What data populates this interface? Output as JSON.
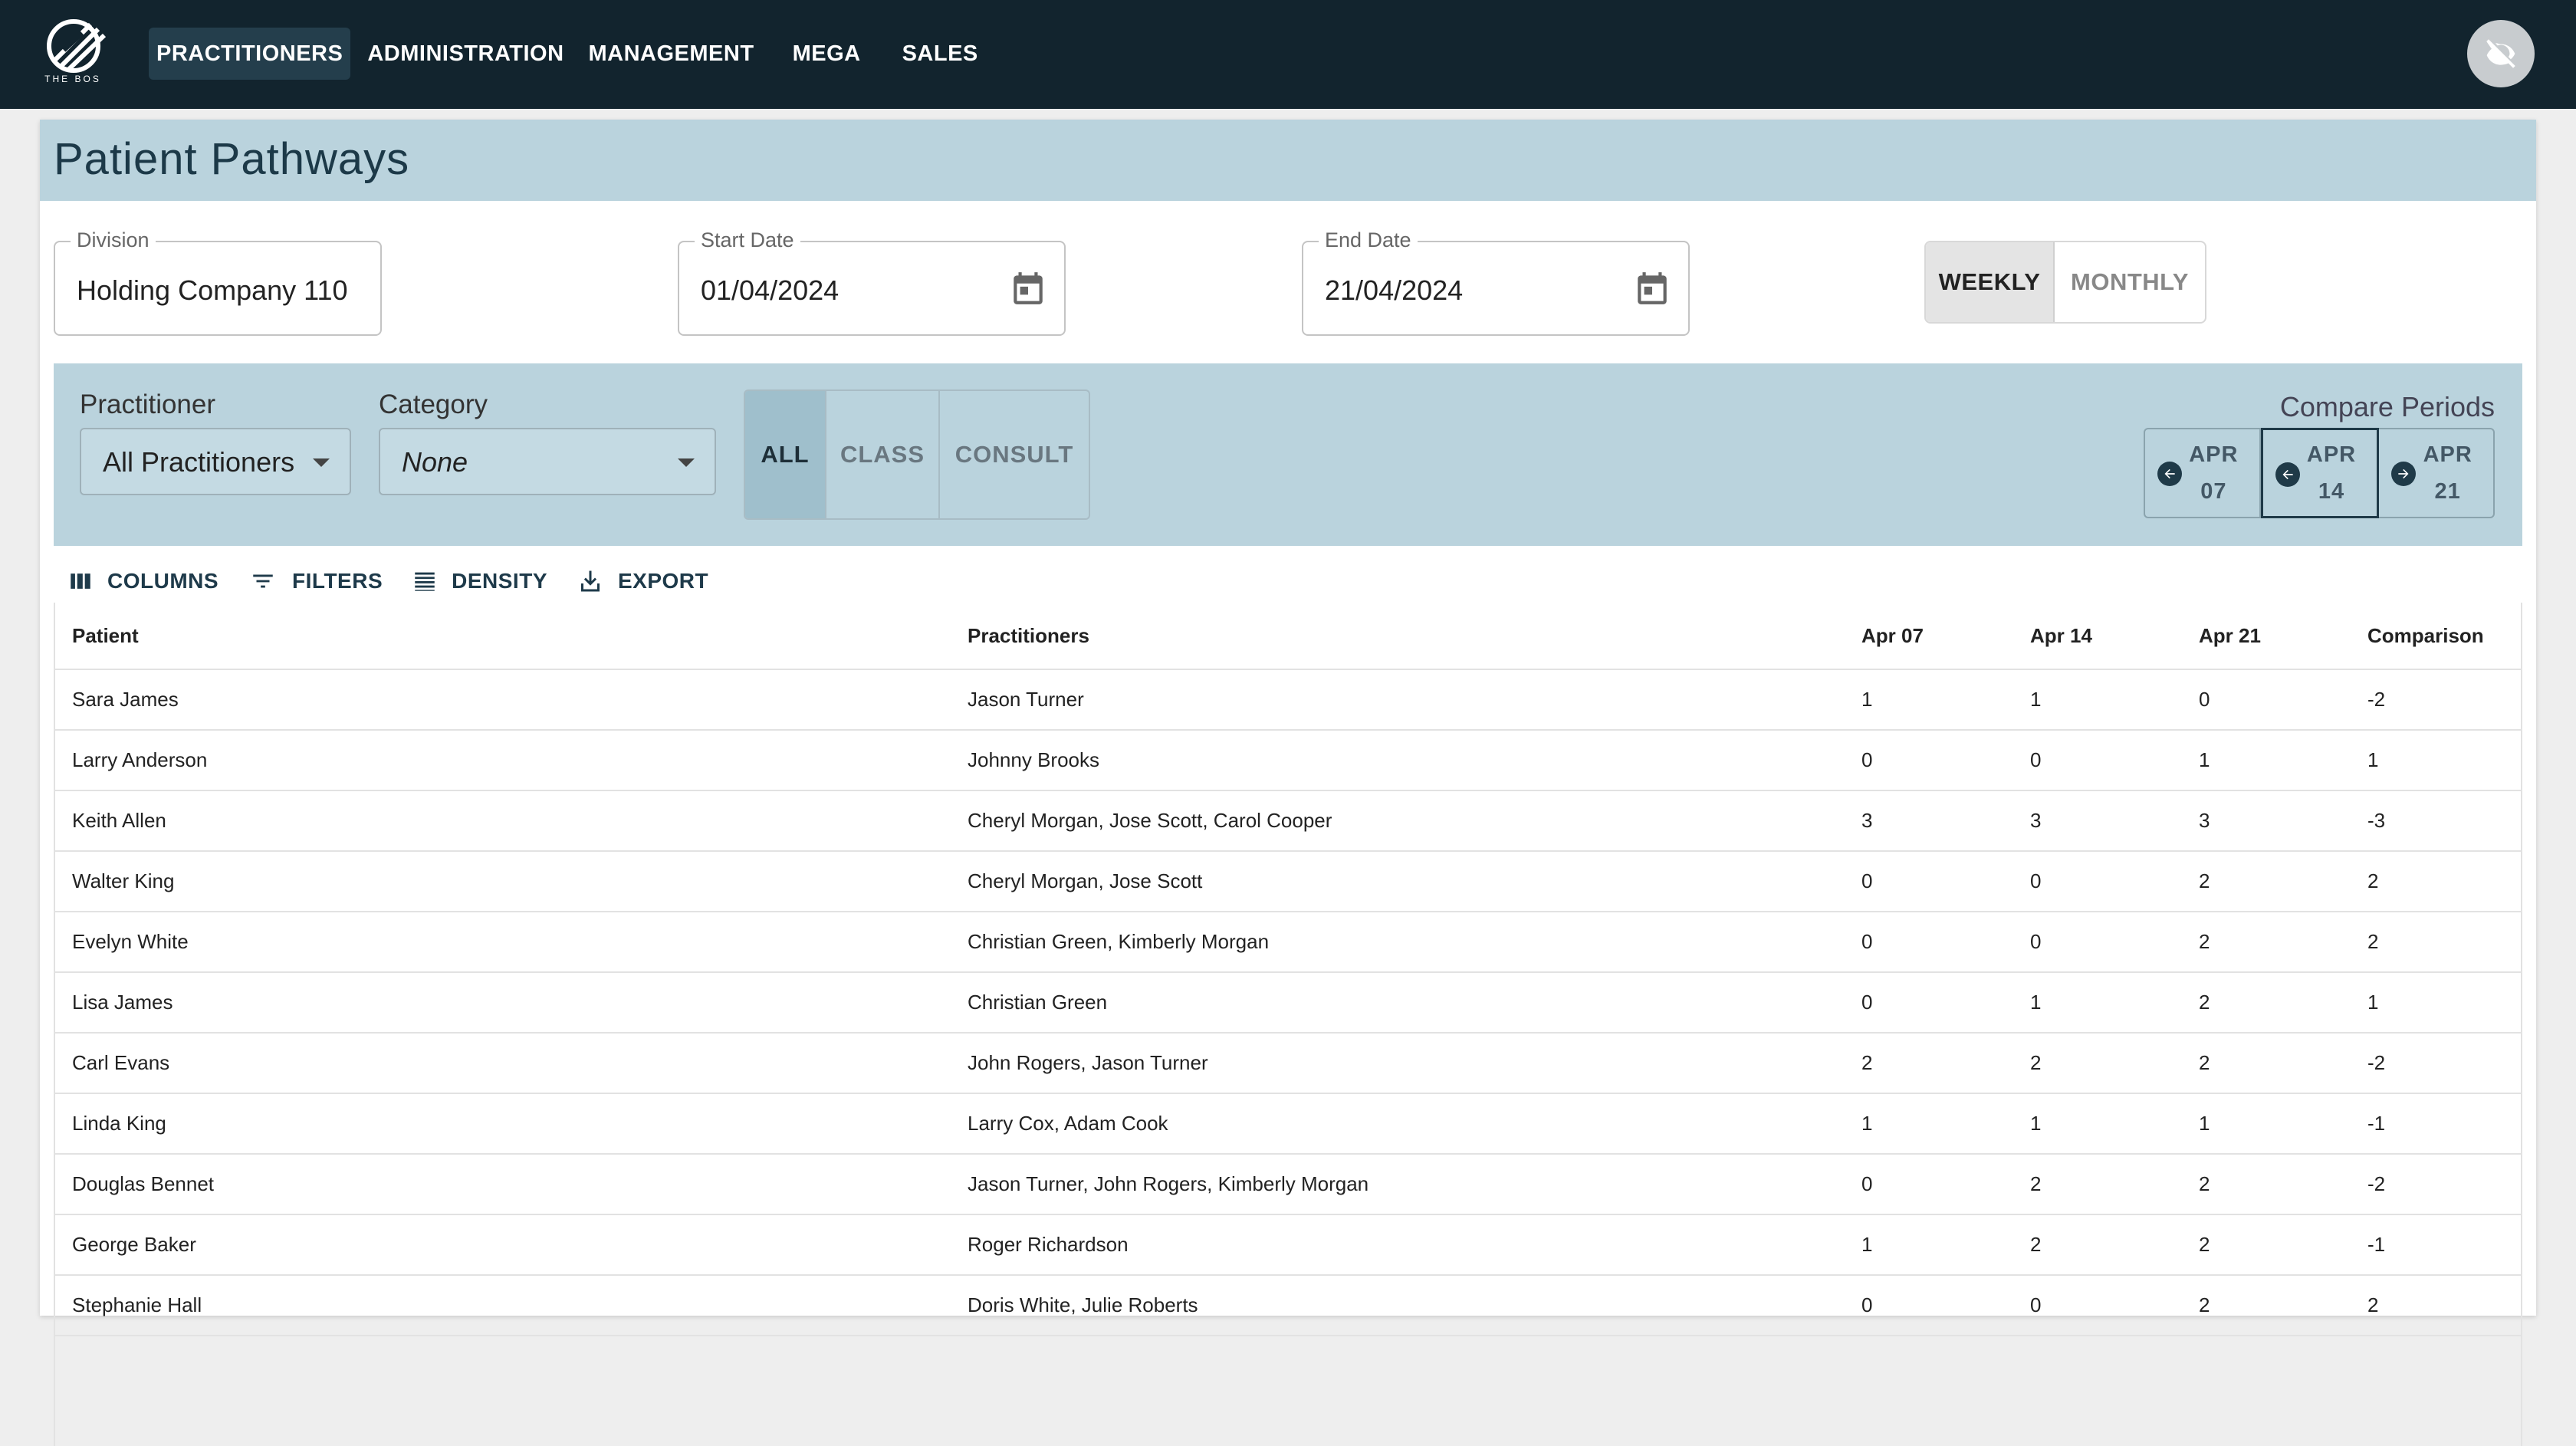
{
  "app": {
    "logo_text": "THE BOS",
    "nav": [
      "PRACTITIONERS",
      "ADMINISTRATION",
      "MANAGEMENT",
      "MEGA",
      "SALES"
    ],
    "active_nav": "PRACTITIONERS"
  },
  "page": {
    "title": "Patient Pathways"
  },
  "fields": {
    "division": {
      "label": "Division",
      "value": "Holding Company 110"
    },
    "start_date": {
      "label": "Start Date",
      "value": "01/04/2024"
    },
    "end_date": {
      "label": "End Date",
      "value": "21/04/2024"
    }
  },
  "period_toggle": {
    "weekly": "WEEKLY",
    "monthly": "MONTHLY",
    "selected": "WEEKLY"
  },
  "filters": {
    "practitioner": {
      "label": "Practitioner",
      "value": "All Practitioners"
    },
    "category": {
      "label": "Category",
      "value": "None"
    },
    "type_segment": {
      "all": "ALL",
      "class": "CLASS",
      "consult": "CONSULT",
      "selected": "ALL"
    },
    "compare": {
      "label": "Compare Periods",
      "periods": [
        {
          "month": "APR",
          "day": "07"
        },
        {
          "month": "APR",
          "day": "14"
        },
        {
          "month": "APR",
          "day": "21"
        }
      ]
    }
  },
  "toolbar": {
    "columns": "COLUMNS",
    "filters": "FILTERS",
    "density": "DENSITY",
    "export": "EXPORT"
  },
  "table": {
    "headers": [
      "Patient",
      "Practitioners",
      "Apr 07",
      "Apr 14",
      "Apr 21",
      "Comparison"
    ],
    "rows": [
      [
        "Sara James",
        "Jason Turner",
        "1",
        "1",
        "0",
        "-2"
      ],
      [
        "Larry Anderson",
        "Johnny Brooks",
        "0",
        "0",
        "1",
        "1"
      ],
      [
        "Keith Allen",
        "Cheryl Morgan, Jose Scott, Carol Cooper",
        "3",
        "3",
        "3",
        "-3"
      ],
      [
        "Walter King",
        "Cheryl Morgan, Jose Scott",
        "0",
        "0",
        "2",
        "2"
      ],
      [
        "Evelyn White",
        "Christian Green, Kimberly Morgan",
        "0",
        "0",
        "2",
        "2"
      ],
      [
        "Lisa James",
        "Christian Green",
        "0",
        "1",
        "2",
        "1"
      ],
      [
        "Carl Evans",
        "John Rogers, Jason Turner",
        "2",
        "2",
        "2",
        "-2"
      ],
      [
        "Linda King",
        "Larry Cox, Adam Cook",
        "1",
        "1",
        "1",
        "-1"
      ],
      [
        "Douglas Bennet",
        "Jason Turner, John Rogers, Kimberly Morgan",
        "0",
        "2",
        "2",
        "-2"
      ],
      [
        "George Baker",
        "Roger Richardson",
        "1",
        "2",
        "2",
        "-1"
      ],
      [
        "Stephanie Hall",
        "Doris White, Julie Roberts",
        "0",
        "0",
        "2",
        "2"
      ]
    ]
  }
}
